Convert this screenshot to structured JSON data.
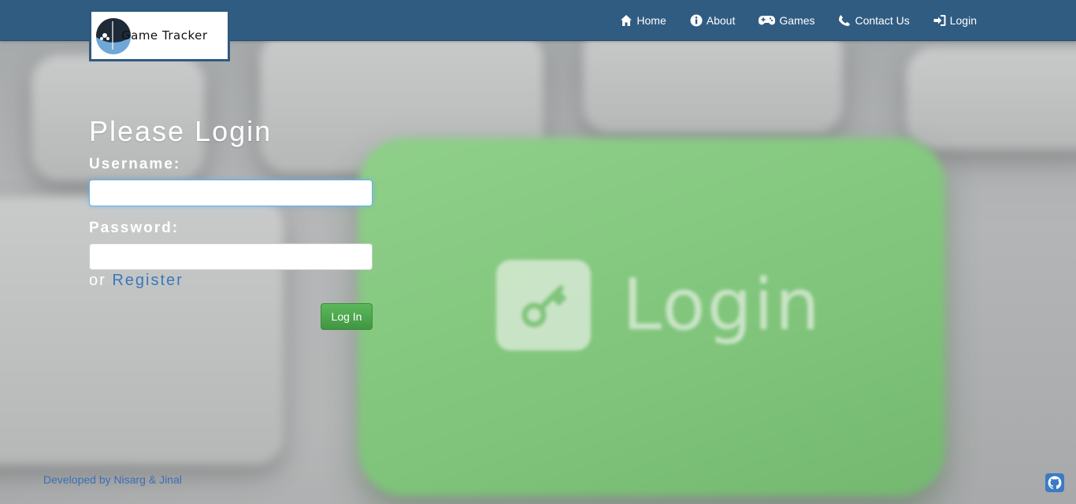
{
  "brand": {
    "name": "Game Tracker",
    "header_color": "#305c82"
  },
  "nav": {
    "items": [
      {
        "label": "Home",
        "icon": "home-icon"
      },
      {
        "label": "About",
        "icon": "info-icon"
      },
      {
        "label": "Games",
        "icon": "gamepad-icon"
      },
      {
        "label": "Contact Us",
        "icon": "phone-icon"
      },
      {
        "label": "Login",
        "icon": "login-icon"
      }
    ]
  },
  "background": {
    "key_label": "Login",
    "accent": "#7fc47a"
  },
  "form": {
    "title": "Please Login",
    "username_label": "Username:",
    "username_value": "",
    "password_label": "Password:",
    "password_value": "",
    "or_text": "or",
    "register_link": "Register",
    "submit_label": "Log In",
    "submit_color": "#5cb85c"
  },
  "footer": {
    "credit": "Developed by Nisarg & Jinal",
    "github_icon": "github-icon"
  }
}
